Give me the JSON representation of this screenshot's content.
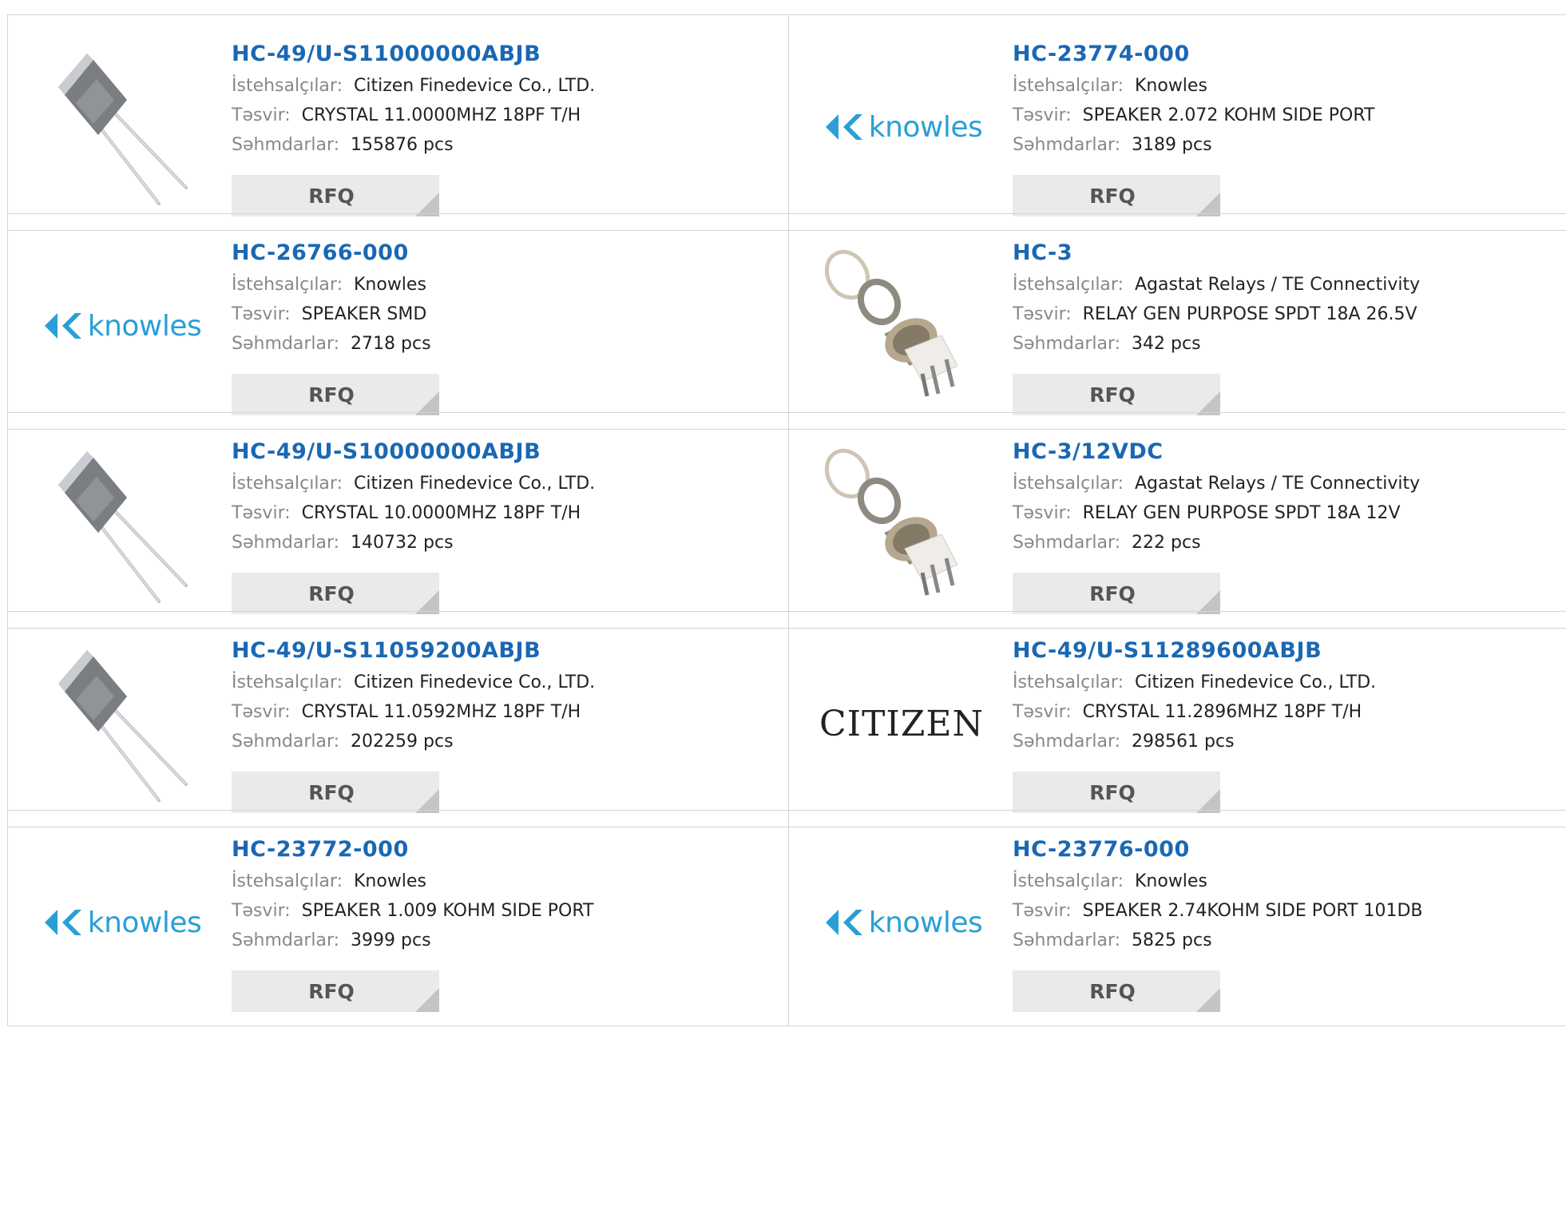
{
  "labels": {
    "manufacturer": "İstehsalçılar:",
    "description": "Təsvir:",
    "stock": "Səhmdarlar:",
    "rfq": "RFQ"
  },
  "products": [
    {
      "part": "HC-49/U-S11000000ABJB",
      "manufacturer": "Citizen Finedevice Co., LTD.",
      "description": "CRYSTAL 11.0000MHZ 18PF T/H",
      "stock": "155876 pcs",
      "image": "crystal-image"
    },
    {
      "part": "HC-23774-000",
      "manufacturer": "Knowles",
      "description": "SPEAKER 2.072 KOHM SIDE PORT",
      "stock": "3189 pcs",
      "image": "knowles-logo",
      "logo_text": "knowles"
    },
    {
      "part": "HC-26766-000",
      "manufacturer": "Knowles",
      "description": "SPEAKER SMD",
      "stock": "2718 pcs",
      "image": "knowles-logo",
      "logo_text": "knowles"
    },
    {
      "part": "HC-3",
      "manufacturer": "Agastat Relays / TE Connectivity",
      "description": "RELAY GEN PURPOSE SPDT 18A 26.5V",
      "stock": "342 pcs",
      "image": "relay-image"
    },
    {
      "part": "HC-49/U-S10000000ABJB",
      "manufacturer": "Citizen Finedevice Co., LTD.",
      "description": "CRYSTAL 10.0000MHZ 18PF T/H",
      "stock": "140732 pcs",
      "image": "crystal-image"
    },
    {
      "part": "HC-3/12VDC",
      "manufacturer": "Agastat Relays / TE Connectivity",
      "description": "RELAY GEN PURPOSE SPDT 18A 12V",
      "stock": "222 pcs",
      "image": "relay-image"
    },
    {
      "part": "HC-49/U-S11059200ABJB",
      "manufacturer": "Citizen Finedevice Co., LTD.",
      "description": "CRYSTAL 11.0592MHZ 18PF T/H",
      "stock": "202259 pcs",
      "image": "crystal-image"
    },
    {
      "part": "HC-49/U-S11289600ABJB",
      "manufacturer": "Citizen Finedevice Co., LTD.",
      "description": "CRYSTAL 11.2896MHZ 18PF T/H",
      "stock": "298561 pcs",
      "image": "citizen-logo",
      "logo_text": "CITIZEN"
    },
    {
      "part": "HC-23772-000",
      "manufacturer": "Knowles",
      "description": "SPEAKER 1.009 KOHM SIDE PORT",
      "stock": "3999 pcs",
      "image": "knowles-logo",
      "logo_text": "knowles"
    },
    {
      "part": "HC-23776-000",
      "manufacturer": "Knowles",
      "description": "SPEAKER 2.74KOHM SIDE PORT 101DB",
      "stock": "5825 pcs",
      "image": "knowles-logo",
      "logo_text": "knowles"
    }
  ],
  "colors": {
    "part_link": "#1a68b3",
    "knowles_brand": "#2a9fd6",
    "rfq_bg": "#eaeaea"
  }
}
